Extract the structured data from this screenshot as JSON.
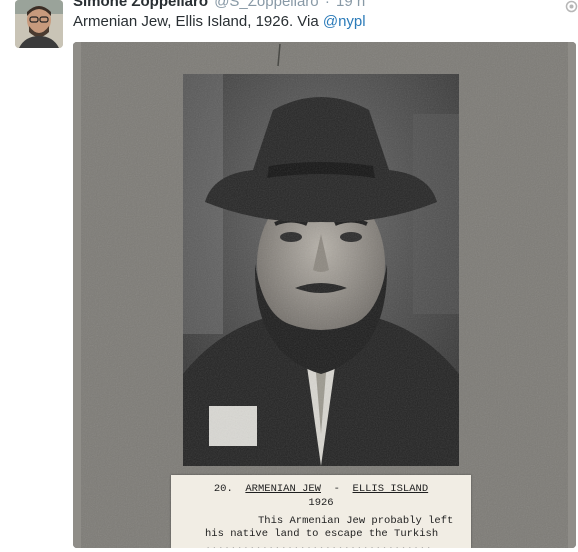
{
  "tweet": {
    "display_name": "Simone Zoppellaro",
    "username": "@S_Zoppellaro",
    "separator": "·",
    "time": "19 h",
    "text": "Armenian Jew, Ellis Island, 1926. Via ",
    "mention": "@nypl",
    "menu_icon": "circle-icon"
  },
  "media": {
    "description": "archival-portrait-photograph",
    "caption_card": {
      "number": "20.",
      "title_subject": "ARMENIAN JEW",
      "dash": "-",
      "title_place": "ELLIS ISLAND",
      "year": "1926",
      "line1": "This Armenian Jew probably left",
      "line2": "his native land to escape the Turkish",
      "line3": "...................................."
    }
  },
  "colors": {
    "name": "#292f33",
    "meta": "#8899a6",
    "link": "#2b7bb9",
    "mat": "#7d7b76",
    "card": "#f1ede4"
  }
}
